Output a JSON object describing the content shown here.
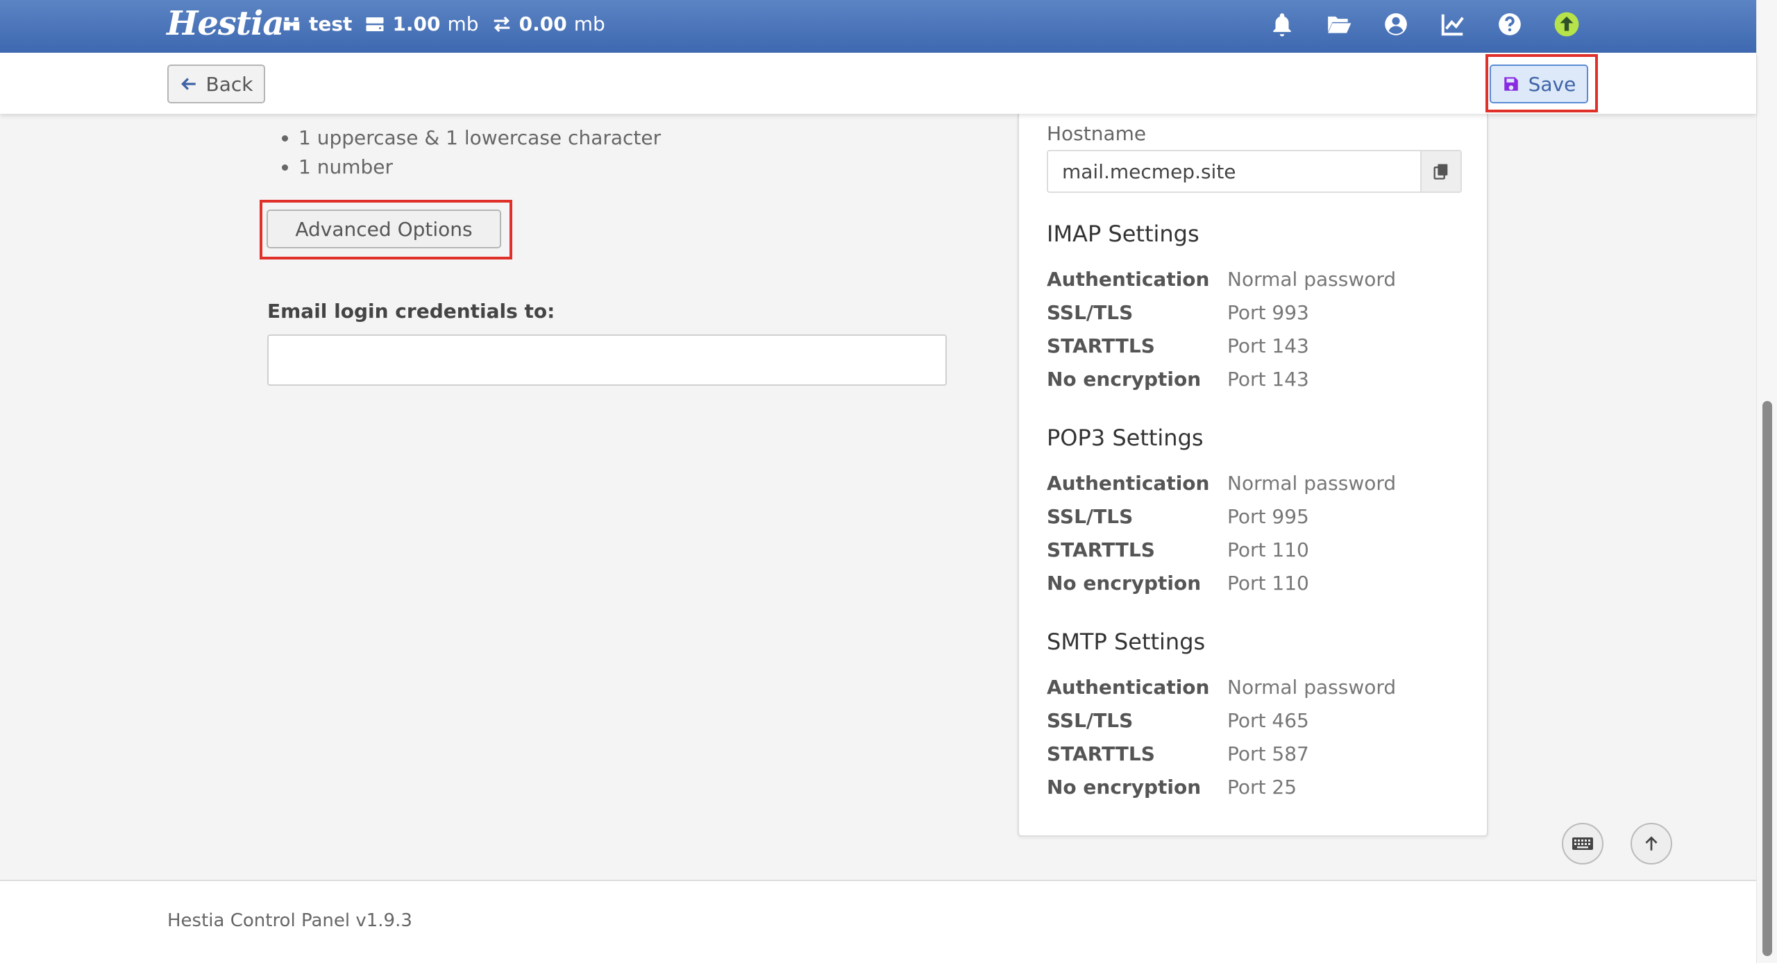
{
  "topbar": {
    "logo": "Hestia",
    "user": "test",
    "disk_num": "1.00",
    "disk_unit": "mb",
    "bandwidth_num": "0.00",
    "bandwidth_unit": "mb",
    "icons": [
      "bell-icon",
      "folder-icon",
      "user-circle-icon",
      "chart-line-icon",
      "question-icon",
      "upgrade-arrow-icon"
    ]
  },
  "toolbar": {
    "back_label": "Back",
    "save_label": "Save"
  },
  "form": {
    "requirements": [
      "1 uppercase & 1 lowercase character",
      "1 number"
    ],
    "advanced_options_label": "Advanced Options",
    "email_credentials_label": "Email login credentials to:",
    "email_credentials_value": ""
  },
  "mail_info": {
    "hostname_label": "Hostname",
    "hostname_value": "mail.mecmep.site",
    "imap": {
      "title": "IMAP Settings",
      "rows": [
        {
          "k": "Authentication",
          "v": "Normal password"
        },
        {
          "k": "SSL/TLS",
          "v": "Port 993"
        },
        {
          "k": "STARTTLS",
          "v": "Port 143"
        },
        {
          "k": "No encryption",
          "v": "Port 143"
        }
      ]
    },
    "pop3": {
      "title": "POP3 Settings",
      "rows": [
        {
          "k": "Authentication",
          "v": "Normal password"
        },
        {
          "k": "SSL/TLS",
          "v": "Port 995"
        },
        {
          "k": "STARTTLS",
          "v": "Port 110"
        },
        {
          "k": "No encryption",
          "v": "Port 110"
        }
      ]
    },
    "smtp": {
      "title": "SMTP Settings",
      "rows": [
        {
          "k": "Authentication",
          "v": "Normal password"
        },
        {
          "k": "SSL/TLS",
          "v": "Port 465"
        },
        {
          "k": "STARTTLS",
          "v": "Port 587"
        },
        {
          "k": "No encryption",
          "v": "Port 25"
        }
      ]
    }
  },
  "footer": {
    "text": "Hestia Control Panel v1.9.3"
  },
  "colors": {
    "topbar": "#4a74ba",
    "accent": "#3f63a6",
    "highlight": "#e0302a",
    "upgrade": "#b6e24a"
  }
}
